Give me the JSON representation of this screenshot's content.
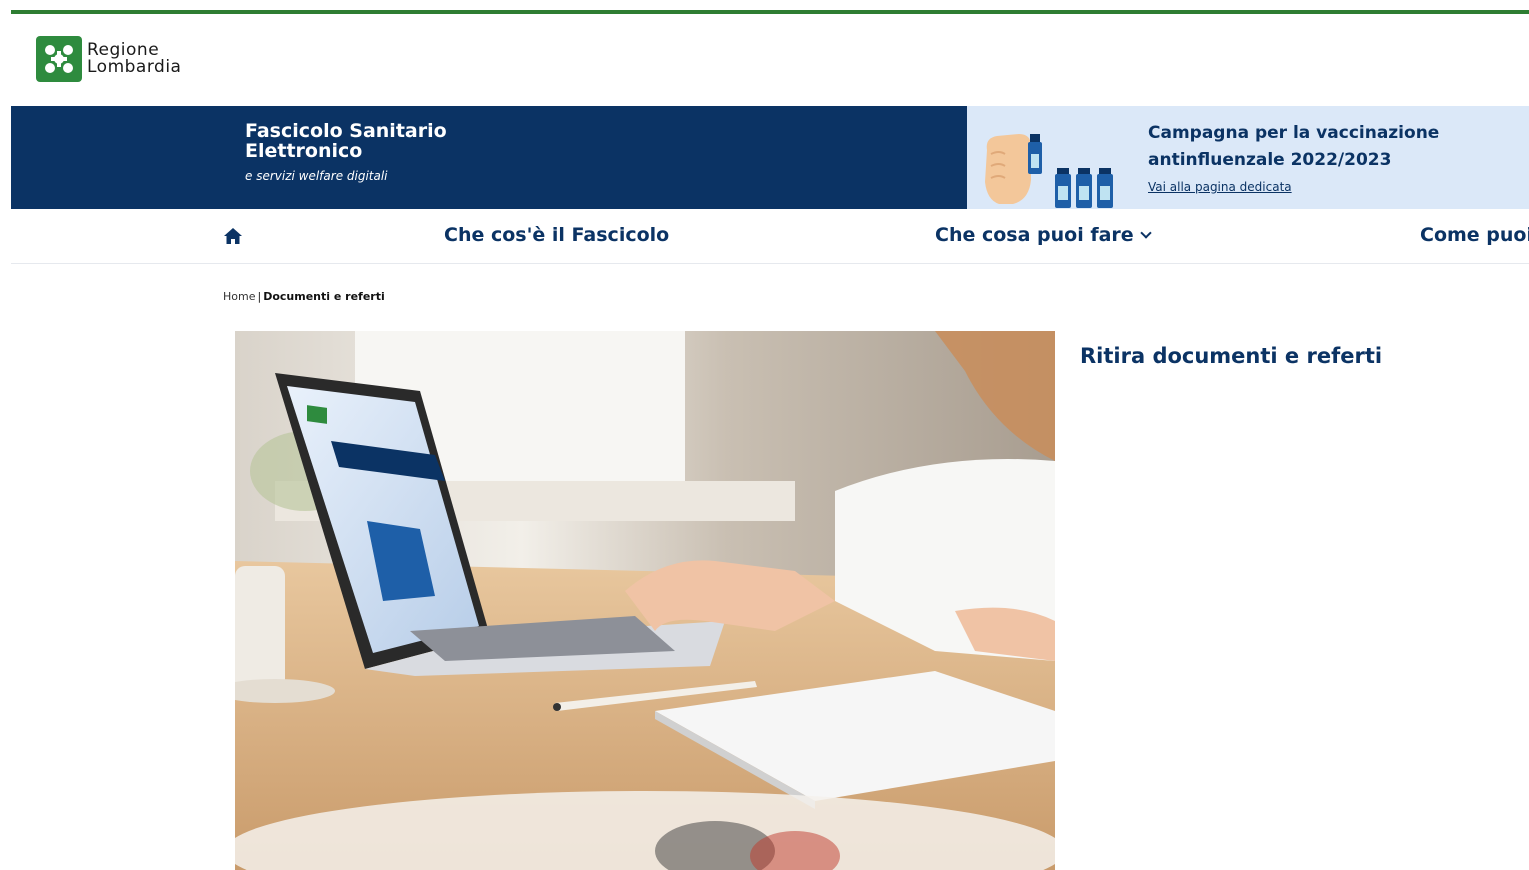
{
  "brand": {
    "line1": "Regione",
    "line2": "Lombardia",
    "color": "#2e8b3e"
  },
  "banner": {
    "title": "Fascicolo Sanitario Elettronico",
    "subtitle": "e servizi welfare digitali",
    "background": "#0b3364"
  },
  "campaign": {
    "title": "Campagna per la vaccinazione antinfluenzale 2022/2023",
    "link": "Vai alla pagina dedicata",
    "background": "#dbe8f8"
  },
  "nav": {
    "home_icon": "home-icon",
    "items": [
      {
        "label": "Che cos'è il Fascicolo"
      },
      {
        "label": "Che cosa puoi fare"
      },
      {
        "label": "Come puoi"
      }
    ]
  },
  "breadcrumb": {
    "home": "Home",
    "separator": "|",
    "current": "Documenti e referti"
  },
  "page": {
    "heading": "Ritira documenti e referti"
  },
  "colors": {
    "accent_green": "#2e7d32",
    "navy": "#0b3364"
  }
}
